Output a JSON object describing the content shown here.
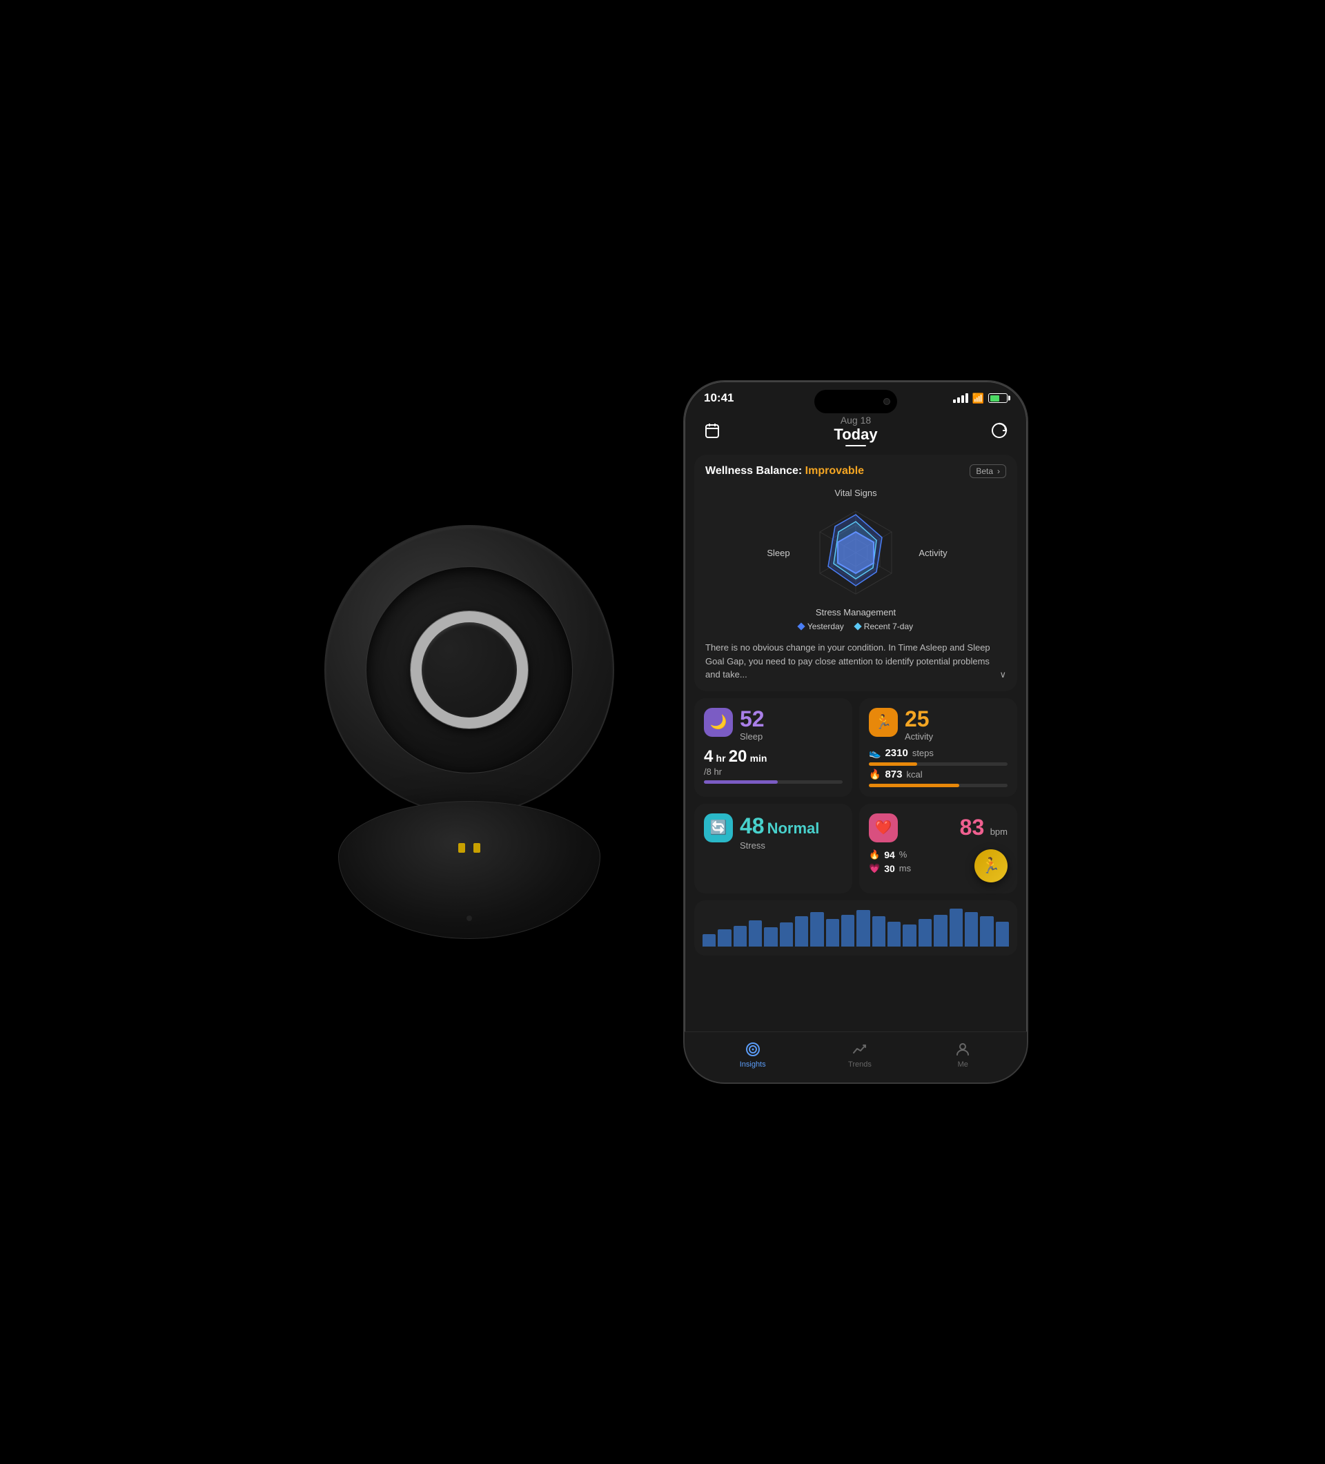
{
  "scene": {
    "background": "#000000"
  },
  "phone": {
    "status_bar": {
      "time": "10:41",
      "battery_pct": "69"
    },
    "header": {
      "date": "Aug 18",
      "title": "Today",
      "icon_left": "calendar-icon",
      "icon_right": "refresh-icon"
    },
    "wellness_card": {
      "prefix": "Wellness Balance:",
      "status": "Improvable",
      "beta_label": "Beta",
      "radar": {
        "top_label": "Vital Signs",
        "left_label": "Sleep",
        "right_label": "Activity",
        "bottom_label": "Stress Management",
        "legend_yesterday": "Yesterday",
        "legend_recent": "Recent 7-day"
      },
      "description": "There is no obvious change in your condition. In Time Asleep and Sleep Goal Gap, you need to pay close attention to identify potential problems and take...",
      "expand_label": "∨"
    },
    "metrics": {
      "sleep": {
        "score": "52",
        "label": "Sleep",
        "duration_h": "4",
        "duration_m": "20",
        "duration_unit": "hr",
        "duration_min_unit": "min",
        "goal": "/8 hr",
        "progress_pct": 53
      },
      "activity": {
        "score": "25",
        "label": "Activity",
        "steps": "2310",
        "steps_unit": "steps",
        "kcal": "873",
        "kcal_unit": "kcal"
      },
      "stress": {
        "number": "48",
        "level": "Normal",
        "label": "Stress"
      },
      "heart": {
        "bpm": "83",
        "bpm_unit": "bpm",
        "hrv_pct": "94",
        "hrv_unit": "%",
        "hrv_ms": "30",
        "hrv_ms_unit": "ms"
      }
    },
    "chart": {
      "bars": [
        3,
        5,
        7,
        9,
        6,
        8,
        11,
        13,
        10,
        12,
        14,
        11,
        9,
        8,
        10,
        12,
        15,
        13,
        11,
        9
      ]
    },
    "tab_bar": {
      "items": [
        {
          "id": "insights",
          "label": "Insights",
          "active": true
        },
        {
          "id": "trends",
          "label": "Trends",
          "active": false
        },
        {
          "id": "me",
          "label": "Me",
          "active": false
        }
      ]
    }
  }
}
